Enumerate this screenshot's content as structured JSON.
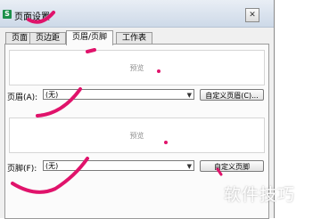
{
  "window": {
    "title": "页面设置",
    "app_icon_glyph": "S",
    "close_glyph": "✕"
  },
  "tabs": [
    "页面",
    "页边距",
    "页眉/页脚",
    "工作表"
  ],
  "header": {
    "preview_label": "预览",
    "field_label": "页眉(A):",
    "value": "(无)",
    "custom_button": "自定义页眉(C)..."
  },
  "footer": {
    "preview_label": "预览",
    "field_label": "页脚(F):",
    "value": "(无)",
    "custom_button": "自定义页脚"
  },
  "watermark": "软件技巧",
  "colors": {
    "annotation": "#e0136b",
    "app_icon": "#1a8f4a"
  }
}
